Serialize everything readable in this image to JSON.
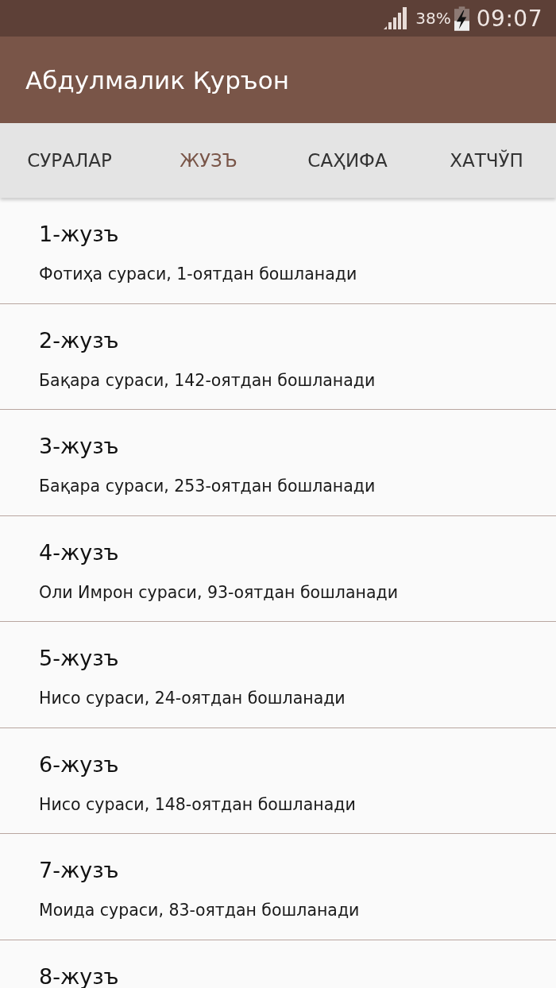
{
  "status_bar": {
    "battery_text": "38%",
    "time": "09:07"
  },
  "app_bar": {
    "title": "Абдулмалик Қуръон"
  },
  "tabs": [
    {
      "label": "СУРАЛАР",
      "selected": false
    },
    {
      "label": "ЖУЗЪ",
      "selected": true
    },
    {
      "label": "САҲИФА",
      "selected": false
    },
    {
      "label": "ХАТЧЎП",
      "selected": false
    }
  ],
  "list": [
    {
      "title": "1-жузъ",
      "subtitle": "Фотиҳа сураси, 1-оятдан бошланади"
    },
    {
      "title": "2-жузъ",
      "subtitle": "Бақара сураси, 142-оятдан бошланади"
    },
    {
      "title": "3-жузъ",
      "subtitle": "Бақара сураси, 253-оятдан бошланади"
    },
    {
      "title": "4-жузъ",
      "subtitle": "Оли Имрон сураси, 93-оятдан бошланади"
    },
    {
      "title": "5-жузъ",
      "subtitle": "Нисо сураси, 24-оятдан бошланади"
    },
    {
      "title": "6-жузъ",
      "subtitle": "Нисо сураси, 148-оятдан бошланади"
    },
    {
      "title": "7-жузъ",
      "subtitle": "Моида сураси, 83-оятдан бошланади"
    },
    {
      "title": "8-жузъ"
    }
  ]
}
